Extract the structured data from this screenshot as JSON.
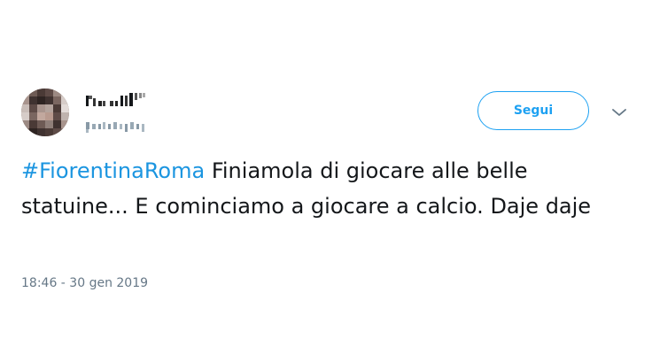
{
  "user": {
    "avatar_colors": [
      "#8f7f79",
      "#5e4b47",
      "#c9bdb8",
      "#3f3230",
      "#a8948d"
    ],
    "name_icon": "pixelated-name",
    "handle_icon": "pixelated-handle"
  },
  "follow_button": {
    "label": "Segui",
    "color": "#1da1f2"
  },
  "menu": {
    "icon": "chevron-down-icon"
  },
  "tweet": {
    "hashtag": "#FiorentinaRoma",
    "text": " Finiamola di giocare alle belle statuine... E cominciamo a giocare a calcio. Daje daje",
    "hashtag_color": "#1b95e0"
  },
  "timestamp": "18:46 - 30 gen 2019"
}
